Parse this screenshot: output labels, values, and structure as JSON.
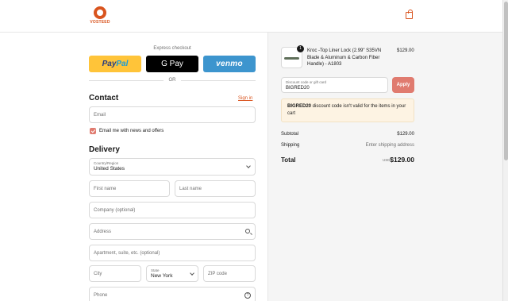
{
  "header": {
    "brand": "VOSTEED",
    "cart_icon": "shopping-bag-icon",
    "accent_color": "#d9541e"
  },
  "express": {
    "label": "Express checkout",
    "paypal_pay": "Pay",
    "paypal_pal": "Pal",
    "gpay_label": "G Pay",
    "venmo_label": "venmo",
    "or_label": "OR"
  },
  "contact": {
    "title": "Contact",
    "signin_label": "Sign in",
    "email_placeholder": "Email",
    "news_checked": true,
    "news_label": "Email me with news and offers"
  },
  "delivery": {
    "title": "Delivery",
    "country_label": "Country/Region",
    "country_value": "United States",
    "first_name_placeholder": "First name",
    "last_name_placeholder": "Last name",
    "company_placeholder": "Company (optional)",
    "address_placeholder": "Address",
    "apartment_placeholder": "Apartment, suite, etc. (optional)",
    "city_placeholder": "City",
    "state_label": "State",
    "state_value": "New York",
    "zip_placeholder": "ZIP code",
    "phone_placeholder": "Phone",
    "help_glyph": "?"
  },
  "order": {
    "product_name": "Kroc -Top Liner Lock (2.99\" S35VN Blade & Aluminum & Carbon Fiber Handle) - A1803",
    "quantity": "1",
    "price": "$129.00"
  },
  "discount": {
    "label": "Discount code or gift card",
    "value": "BIGRED20",
    "apply_label": "Apply",
    "error_code": "BIGRED20",
    "error_message": " discount code isn't valid for the items in your cart"
  },
  "summary": {
    "subtotal_label": "Subtotal",
    "subtotal_value": "$129.00",
    "shipping_label": "Shipping",
    "shipping_value": "Enter shipping address",
    "total_label": "Total",
    "currency": "USD",
    "total_value": "$129.00"
  }
}
